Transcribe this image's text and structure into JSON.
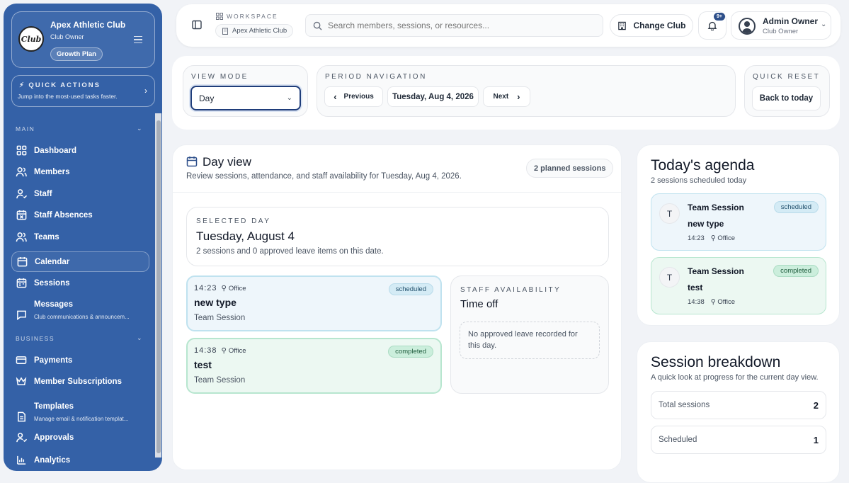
{
  "sidebar": {
    "club": {
      "name": "Apex Athletic Club",
      "role": "Club Owner",
      "plan": "Growth Plan",
      "logo_text": "Club"
    },
    "quick_actions": {
      "title": "QUICK ACTIONS",
      "subtitle": "Jump into the most-used tasks faster."
    },
    "sections": [
      {
        "label": "MAIN",
        "items": [
          {
            "label": "Dashboard",
            "icon": "dashboard-icon"
          },
          {
            "label": "Members",
            "icon": "members-icon"
          },
          {
            "label": "Staff",
            "icon": "staff-icon"
          },
          {
            "label": "Staff Absences",
            "icon": "calendar-x-icon"
          },
          {
            "label": "Teams",
            "icon": "teams-icon"
          },
          {
            "label": "Calendar",
            "icon": "calendar-icon",
            "active": true
          },
          {
            "label": "Sessions",
            "icon": "sessions-icon"
          },
          {
            "label": "Messages",
            "icon": "message-icon",
            "sub": "Club communications & announcem..."
          }
        ]
      },
      {
        "label": "BUSINESS",
        "items": [
          {
            "label": "Payments",
            "icon": "credit-card-icon"
          },
          {
            "label": "Member Subscriptions",
            "icon": "crown-icon"
          },
          {
            "label": "Templates",
            "icon": "template-icon",
            "sub": "Manage email & notification templat..."
          },
          {
            "label": "Approvals",
            "icon": "user-check-icon"
          },
          {
            "label": "Analytics",
            "icon": "analytics-icon"
          }
        ]
      }
    ]
  },
  "topbar": {
    "workspace_label": "WORKSPACE",
    "workspace_name": "Apex Athletic Club",
    "search_placeholder": "Search members, sessions, or resources...",
    "change_club": "Change Club",
    "notification_badge": "9+",
    "user": {
      "name": "Admin Owner",
      "role": "Club Owner"
    }
  },
  "controls": {
    "view_mode": {
      "label": "VIEW MODE",
      "value": "Day"
    },
    "period": {
      "label": "PERIOD NAVIGATION",
      "previous": "Previous",
      "current": "Tuesday, Aug 4, 2026",
      "next": "Next"
    },
    "reset": {
      "label": "QUICK RESET",
      "button": "Back to today"
    }
  },
  "day_view": {
    "title": "Day view",
    "subtitle": "Review sessions, attendance, and staff availability for Tuesday, Aug 4, 2026.",
    "planned": "2 planned sessions",
    "selected_day": {
      "label": "SELECTED DAY",
      "date": "Tuesday, August 4",
      "summary": "2 sessions and 0 approved leave items on this date."
    },
    "sessions": [
      {
        "time": "14:23",
        "location": "Office",
        "name": "new type",
        "type": "Team Session",
        "status": "scheduled"
      },
      {
        "time": "14:38",
        "location": "Office",
        "name": "test",
        "type": "Team Session",
        "status": "completed"
      }
    ],
    "staff": {
      "label": "STAFF AVAILABILITY",
      "title": "Time off",
      "empty": "No approved leave recorded for this day."
    }
  },
  "agenda": {
    "title": "Today's agenda",
    "subtitle": "2 sessions scheduled today",
    "items": [
      {
        "initial": "T",
        "name": "Team Session",
        "type": "new type",
        "time": "14:23",
        "location": "Office",
        "status": "scheduled"
      },
      {
        "initial": "T",
        "name": "Team Session",
        "type": "test",
        "time": "14:38",
        "location": "Office",
        "status": "completed"
      }
    ]
  },
  "breakdown": {
    "title": "Session breakdown",
    "subtitle": "A quick look at progress for the current day view.",
    "rows": [
      {
        "label": "Total sessions",
        "value": "2"
      },
      {
        "label": "Scheduled",
        "value": "1"
      }
    ]
  },
  "colors": {
    "sidebar": "#3461a7",
    "scheduled": "#eef6fb",
    "completed": "#ecf8f2",
    "accent": "#1f3d7a"
  }
}
